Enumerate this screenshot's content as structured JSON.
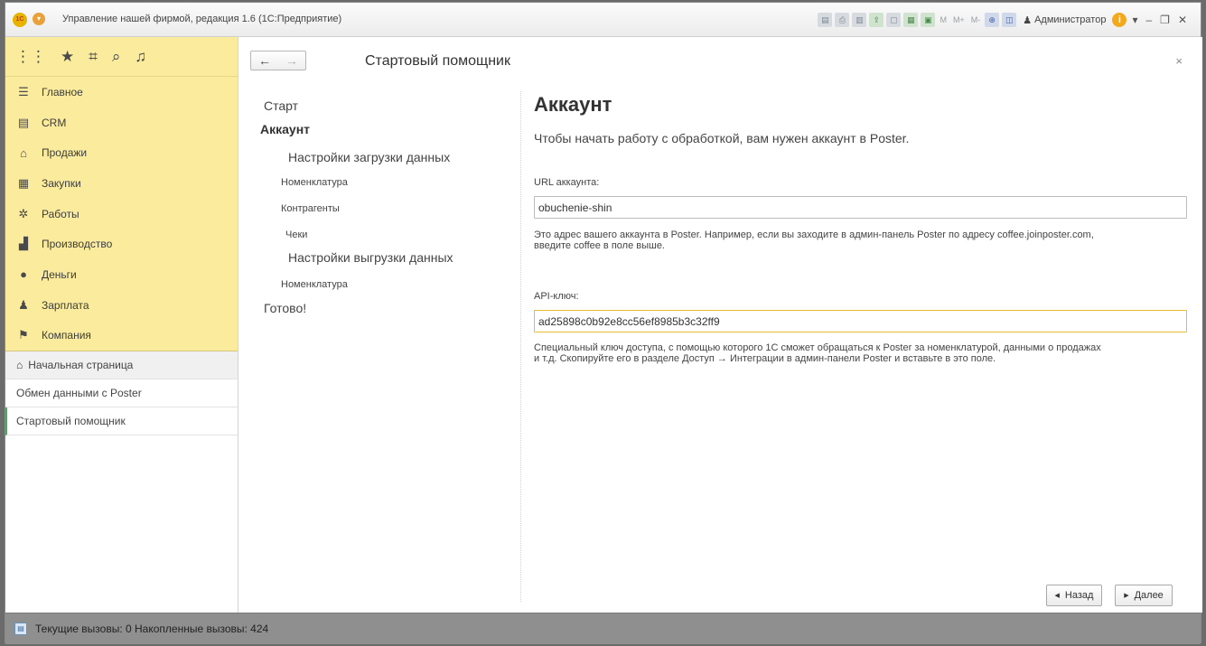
{
  "window": {
    "title": "Управление нашей фирмой, редакция 1.6  (1С:Предприятие)",
    "logo_text": "1С",
    "user": "Администратор"
  },
  "toolbar": {
    "icons": [
      "apps-grid-icon",
      "favorites-star-icon",
      "history-icon",
      "search-icon",
      "notifications-bell-icon"
    ]
  },
  "sections": [
    {
      "label": "Главное",
      "icon": "☰",
      "icon_name": "menu-lines-icon"
    },
    {
      "label": "CRM",
      "icon": "▤",
      "icon_name": "crm-icon"
    },
    {
      "label": "Продажи",
      "icon": "⌂",
      "icon_name": "basket-icon"
    },
    {
      "label": "Закупки",
      "icon": "▦",
      "icon_name": "purchases-icon"
    },
    {
      "label": "Работы",
      "icon": "✲",
      "icon_name": "tools-icon"
    },
    {
      "label": "Производство",
      "icon": "▟",
      "icon_name": "factory-icon"
    },
    {
      "label": "Деньги",
      "icon": "●",
      "icon_name": "money-icon"
    },
    {
      "label": "Зарплата",
      "icon": "♟",
      "icon_name": "people-icon"
    },
    {
      "label": "Компания",
      "icon": "⚑",
      "icon_name": "flag-icon"
    }
  ],
  "open_windows": {
    "home": "Начальная страница",
    "items": [
      "Обмен данными с Poster",
      "Стартовый помощник"
    ]
  },
  "form": {
    "title": "Стартовый помощник"
  },
  "steps": {
    "start": "Старт",
    "account": "Аккаунт",
    "load_settings": "Настройки загрузки данных",
    "load_nomenclature": "Номенклатура",
    "load_counterparties": "Контрагенты",
    "load_receipts": "Чеки",
    "unload_settings": "Настройки выгрузки данных",
    "unload_nomenclature": "Номенклатура",
    "done": "Готово!"
  },
  "content": {
    "heading": "Аккаунт",
    "lead": "Чтобы начать работу с обработкой, вам нужен аккаунт в Poster.",
    "url_label": "URL аккаунта:",
    "url_value": "obuchenie-shin",
    "url_hint_1": "Это адрес вашего аккаунта в Poster. Например, если вы заходите в админ-панель Poster по адресу coffee.joinposter.com,",
    "url_hint_2": "введите coffee в поле выше.",
    "api_label": "API-ключ:",
    "api_value": "ad25898c0b92e8cc56ef8985b3c32ff9",
    "api_hint_1": "Специальный ключ доступа, с помощью которого 1С сможет обращаться к Poster за номенклатурой, данными о продажах",
    "api_hint_2": "и т.д. Скопируйте его в разделе Доступ → Интеграции в админ-панели Poster и вставьте в это поле."
  },
  "buttons": {
    "back": "Назад",
    "next": "Далее"
  },
  "statusbar": {
    "text": "Текущие вызовы: 0   Накопленные вызовы: 424"
  },
  "colors": {
    "sections_bg": "#fbec9d",
    "active_marker": "#4aa861",
    "focus_border": "#e6be2e",
    "statusbar_bg": "#8f8f8f"
  }
}
